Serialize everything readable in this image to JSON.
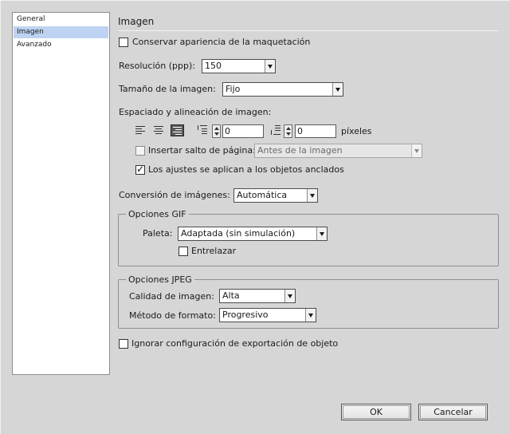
{
  "sidebar": {
    "items": [
      {
        "label": "General"
      },
      {
        "label": "Imagen"
      },
      {
        "label": "Avanzado"
      }
    ]
  },
  "section_title": "Imagen",
  "preserve_layout": {
    "label": "Conservar apariencia de la maquetación",
    "checked": false
  },
  "resolution": {
    "label": "Resolución (ppp):",
    "value": "150"
  },
  "image_size": {
    "label": "Tamaño de la imagen:",
    "value": "Fijo"
  },
  "spacing": {
    "label": "Espaciado y alineación de imagen:",
    "space_before": "0",
    "space_after": "0",
    "units": "píxeles"
  },
  "page_break": {
    "label": "Insertar salto de página:",
    "checked": false,
    "value": "Antes de la imagen"
  },
  "anchored": {
    "label": "Los ajustes se aplican a los objetos anclados",
    "checked": true
  },
  "conversion": {
    "label": "Conversión de imágenes:",
    "value": "Automática"
  },
  "gif": {
    "title": "Opciones GIF",
    "palette_label": "Paleta:",
    "palette_value": "Adaptada (sin simulación)",
    "interlace_label": "Entrelazar",
    "interlace_checked": false
  },
  "jpeg": {
    "title": "Opciones JPEG",
    "quality_label": "Calidad de imagen:",
    "quality_value": "Alta",
    "method_label": "Método de formato:",
    "method_value": "Progresivo"
  },
  "ignore_export": {
    "label": "Ignorar configuración de exportación de objeto",
    "checked": false
  },
  "buttons": {
    "ok": "OK",
    "cancel": "Cancelar"
  }
}
